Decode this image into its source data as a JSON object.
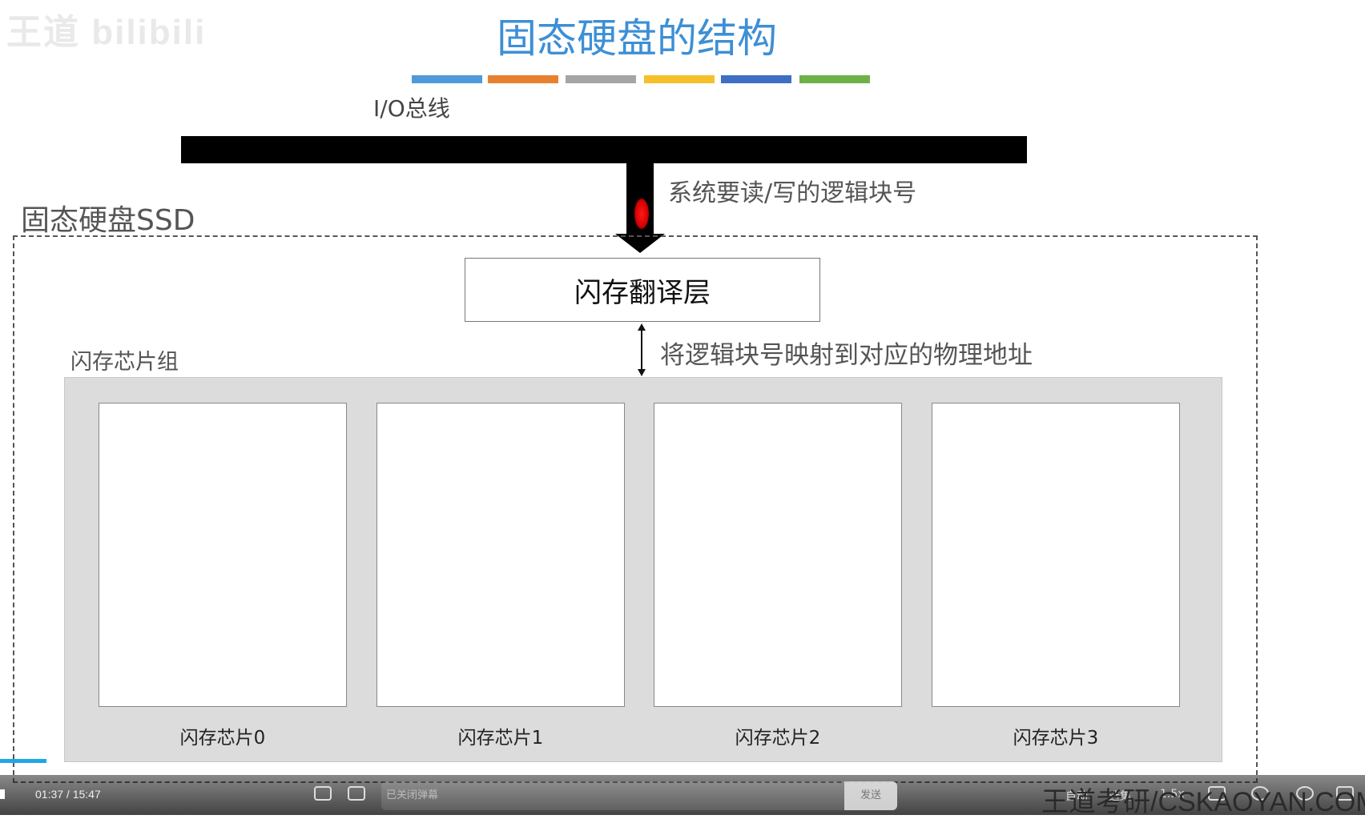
{
  "slide": {
    "watermark": "王道 bilibili",
    "title": "固态硬盘的结构",
    "color_strip": [
      "#4f9ad8",
      "#e8812f",
      "#a5a5a5",
      "#f6c02b",
      "#3f6fc4",
      "#6db246"
    ],
    "bus_label": "I/O总线",
    "read_write_label": "系统要读/写的逻辑块号",
    "ssd_label": "固态硬盘SSD",
    "ftl_label": "闪存翻译层",
    "map_label": "将逻辑块号映射到对应的物理地址",
    "chip_group_label": "闪存芯片组",
    "chips": [
      "闪存芯片0",
      "闪存芯片1",
      "闪存芯片2",
      "闪存芯片3"
    ]
  },
  "player": {
    "time": "01:37 / 15:47",
    "danmaku_placeholder": "已关闭弹幕",
    "send_label": "发送",
    "quality_label": "自动",
    "episodes_label": "选集",
    "speed_label": "1.5x",
    "brand": "王道考研/CSKAOYAN.COM",
    "progress_color": "#1fa6e8"
  }
}
